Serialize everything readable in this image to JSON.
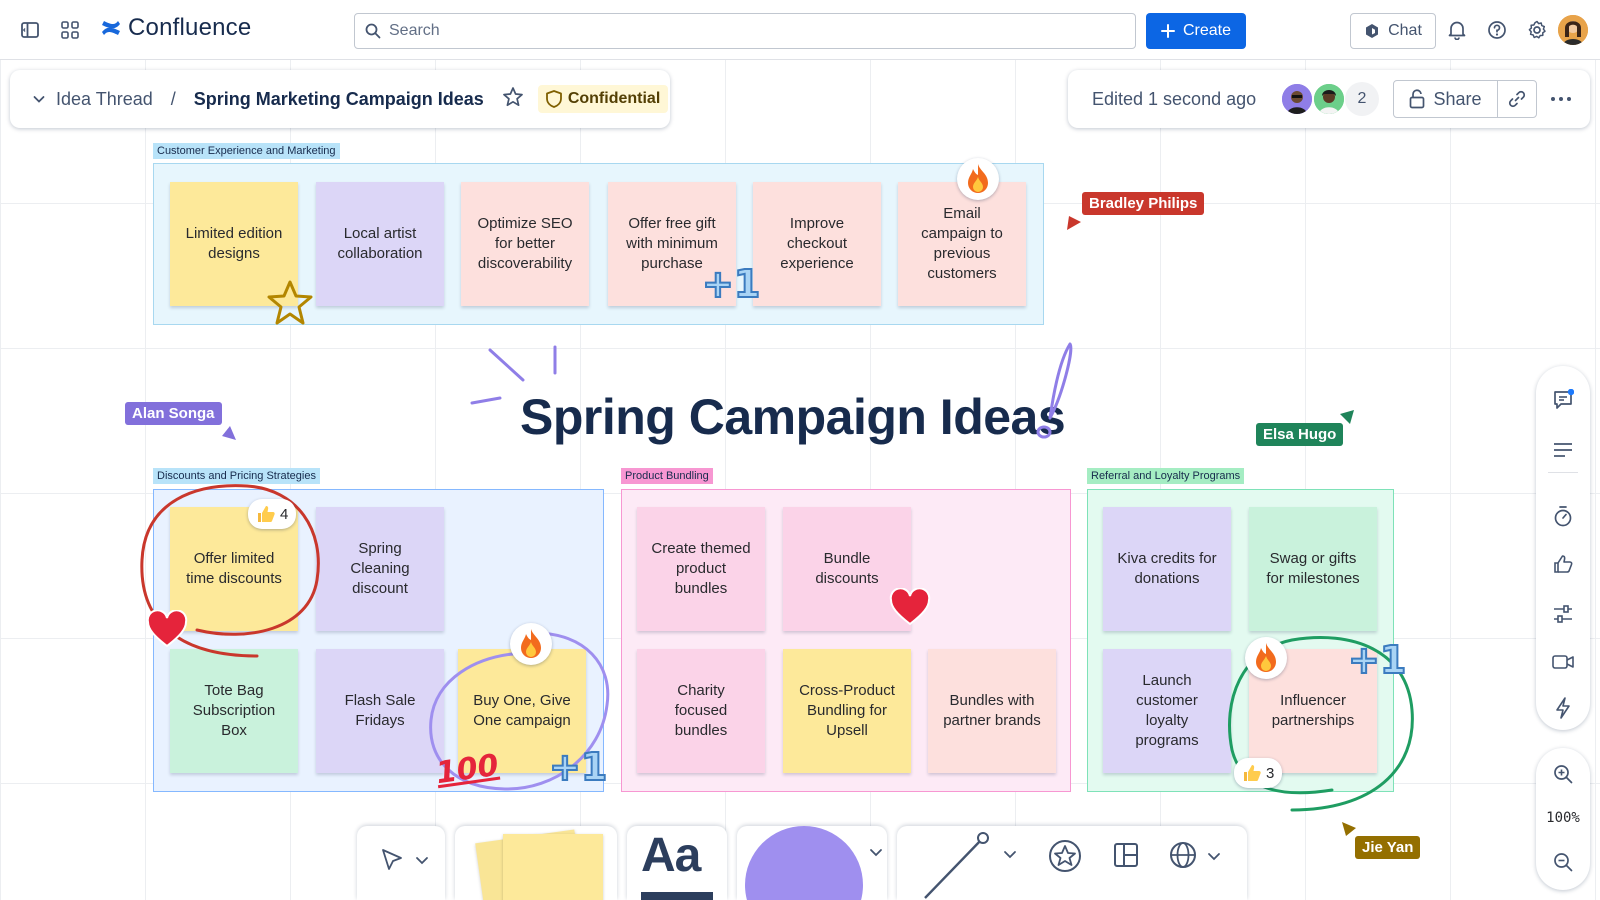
{
  "topbar": {
    "app_name": "Confluence",
    "search_placeholder": "Search",
    "create_label": "Create",
    "chat_label": "Chat"
  },
  "breadcrumb": {
    "space": "Idea Thread",
    "separator": "/",
    "page_title": "Spring Marketing Campaign Ideas",
    "badge": "Confidential"
  },
  "status": {
    "edited": "Edited 1 second ago",
    "collaborator_count": "2",
    "share_label": "Share"
  },
  "canvas": {
    "title": "Spring Campaign Ideas",
    "sections": {
      "cx": {
        "label": "Customer Experience and Marketing",
        "notes": [
          "Limited edition designs",
          "Local artist collaboration",
          "Optimize SEO for better discoverability",
          "Offer free gift with minimum purchase",
          "Improve checkout experience",
          "Email campaign to previous customers"
        ]
      },
      "discounts": {
        "label": "Discounts and Pricing Strategies",
        "notes": [
          "Offer limited time discounts",
          "Spring Cleaning discount",
          "Tote Bag Subscription Box",
          "Flash Sale Fridays",
          "Buy One, Give One campaign"
        ]
      },
      "bundling": {
        "label": "Product Bundling",
        "notes": [
          "Create themed product bundles",
          "Bundle discounts",
          "Charity focused bundles",
          "Cross-Product Bundling for Upsell",
          "Bundles with partner brands"
        ]
      },
      "referral": {
        "label": "Referral and Loyalty Programs",
        "notes": [
          "Kiva credits for donations",
          "Swag or gifts for milestones",
          "Launch customer loyalty programs",
          "Influencer partnerships"
        ]
      }
    },
    "cursors": [
      "Bradley Philips",
      "Alan Songa",
      "Elsa Hugo",
      "Jie Yan"
    ],
    "reactions": {
      "thumbs_a": "4",
      "thumbs_b": "3"
    },
    "stickers": {
      "plus_one": "+1",
      "hundred": "100"
    }
  },
  "right_toolbar": {
    "zoom": "100%"
  },
  "bottom_toolbar": {
    "text_tool": "Aa"
  },
  "colors": {
    "primary": "#0c66e4",
    "bradley": "#c9372c",
    "alan": "#8270db",
    "elsa": "#1f845a",
    "jie": "#946f00"
  }
}
